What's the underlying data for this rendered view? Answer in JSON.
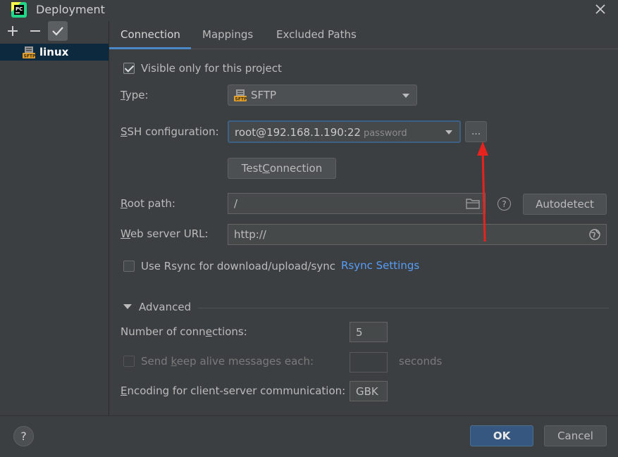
{
  "window": {
    "title": "Deployment"
  },
  "toolbar": {
    "add": "+",
    "remove": "−"
  },
  "servers": [
    {
      "name": "linux",
      "icon": "sftp-server-icon"
    }
  ],
  "tabs": [
    "Connection",
    "Mappings",
    "Excluded Paths"
  ],
  "form": {
    "visible_only": {
      "label": "Visible only for this project",
      "checked": true
    },
    "type": {
      "label_pre": "",
      "label_u": "T",
      "label_post": "ype:",
      "value": "SFTP"
    },
    "ssh": {
      "label_u": "S",
      "label_post": "SH configuration:",
      "value": "root@192.168.1.190:22",
      "auth": "password",
      "more": "..."
    },
    "test_connection": {
      "pre": "Test ",
      "u": "C",
      "post": "onnection"
    },
    "root_path": {
      "label_u": "R",
      "label_post": "oot path:",
      "value": "/",
      "autodetect": "Autodetect"
    },
    "web_url": {
      "label_u": "W",
      "label_post": "eb server URL:",
      "value": "http://"
    },
    "rsync": {
      "label": "Use Rsync for download/upload/sync",
      "link": "Rsync Settings",
      "checked": false
    }
  },
  "advanced": {
    "header": "Advanced",
    "connections": {
      "pre": "Number of conn",
      "u": "e",
      "post": "ctions:",
      "value": "5"
    },
    "keep_alive": {
      "pre": "Send ",
      "u": "k",
      "post": "eep alive messages each:",
      "value": "",
      "unit": "seconds"
    },
    "encoding": {
      "u": "E",
      "post": "ncoding for client-server communication:",
      "value": "GBK"
    }
  },
  "footer": {
    "help": "?",
    "ok": "OK",
    "cancel": "Cancel"
  },
  "colors": {
    "accent": "#4a88c7",
    "ok": "#365880",
    "link": "#589df6",
    "annotation": "#e8231e"
  }
}
